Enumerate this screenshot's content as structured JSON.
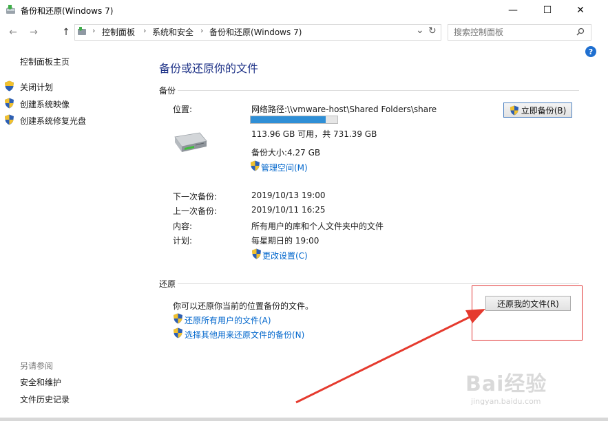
{
  "window": {
    "title": "备份和还原(Windows 7)",
    "icon": "backup-restore-icon",
    "minimize_glyph": "—",
    "maximize_glyph": "☐",
    "close_glyph": "✕"
  },
  "nav": {
    "back_glyph": "←",
    "forward_glyph": "→",
    "up_glyph": "↑",
    "refresh_glyph": "↻",
    "dropdown_glyph": "⌄",
    "breadcrumb": [
      "控制面板",
      "系统和安全",
      "备份和还原(Windows 7)"
    ],
    "separator": "›",
    "search_placeholder": "搜索控制面板"
  },
  "sidebar": {
    "home": "控制面板主页",
    "items": [
      {
        "label": "关闭计划"
      },
      {
        "label": "创建系统映像"
      },
      {
        "label": "创建系统修复光盘"
      }
    ],
    "see_also_title": "另请参阅",
    "see_also": [
      "安全和维护",
      "文件历史记录"
    ]
  },
  "main": {
    "title": "备份或还原你的文件",
    "backup": {
      "section_title": "备份",
      "location_label": "位置:",
      "location_value": "网络路径:\\\\vmware-host\\Shared Folders\\share",
      "usage_fraction": 0.155,
      "space_text": "113.96 GB 可用，共 731.39 GB",
      "backup_size": "备份大小:4.27 GB",
      "manage_space_link": "管理空间(M)",
      "backup_now_button": "立即备份(B)",
      "next_backup_label": "下一次备份:",
      "next_backup_value": "2019/10/13 19:00",
      "last_backup_label": "上一次备份:",
      "last_backup_value": "2019/10/11 16:25",
      "contents_label": "内容:",
      "contents_value": "所有用户的库和个人文件夹中的文件",
      "schedule_label": "计划:",
      "schedule_value": "每星期日的 19:00",
      "change_settings_link": "更改设置(C)"
    },
    "restore": {
      "section_title": "还原",
      "description": "你可以还原你当前的位置备份的文件。",
      "restore_button": "还原我的文件(R)",
      "restore_all_link": "还原所有用户的文件(A)",
      "select_backup_link": "选择其他用来还原文件的备份(N)"
    }
  },
  "help_glyph": "?",
  "watermark": {
    "brand": "Bai经验",
    "url": "jingyan.baidu.com"
  },
  "colors": {
    "accent_title": "#1e3287",
    "link": "#0066cc",
    "progress": "#2f8fd6",
    "annotation": "#e03030"
  }
}
